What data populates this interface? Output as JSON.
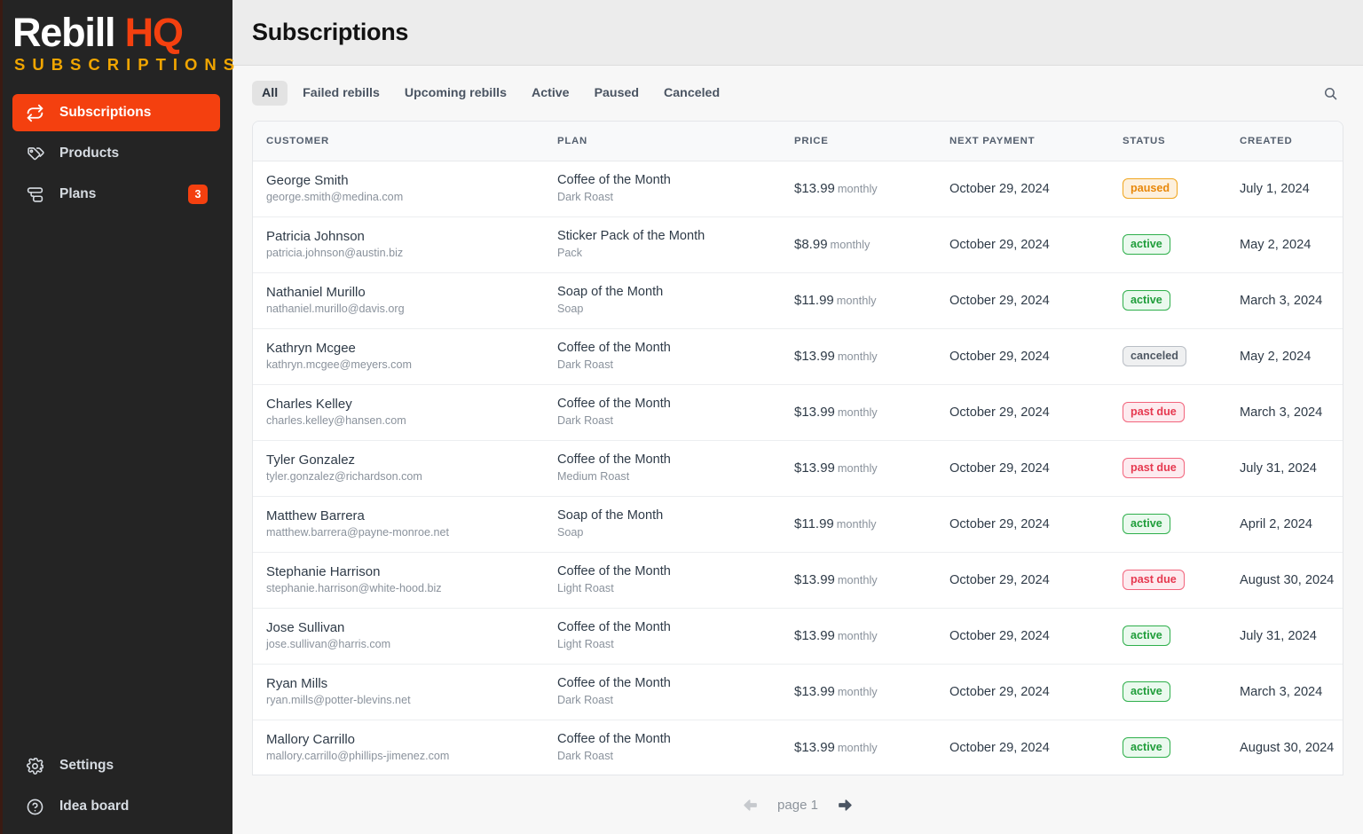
{
  "sidebar": {
    "logo": {
      "name_1": "Rebill",
      "name_2": "HQ",
      "tagline": "SUBSCRIPTIONS"
    },
    "items": [
      {
        "label": "Subscriptions",
        "icon": "refresh-sync-icon",
        "active": true,
        "badge": ""
      },
      {
        "label": "Products",
        "icon": "tag-icon",
        "active": false,
        "badge": ""
      },
      {
        "label": "Plans",
        "icon": "layers-icon",
        "active": false,
        "badge": "3"
      }
    ],
    "bottom_items": [
      {
        "label": "Settings",
        "icon": "gear-icon"
      },
      {
        "label": "Idea board",
        "icon": "question-circle-icon"
      }
    ],
    "accent_color": "#f4400f",
    "tagline_color": "#f0a500",
    "background_color": "#242424"
  },
  "header": {
    "title": "Subscriptions"
  },
  "toolbar": {
    "tabs": [
      {
        "label": "All",
        "selected": true
      },
      {
        "label": "Failed rebills",
        "selected": false
      },
      {
        "label": "Upcoming rebills",
        "selected": false
      },
      {
        "label": "Active",
        "selected": false
      },
      {
        "label": "Paused",
        "selected": false
      },
      {
        "label": "Canceled",
        "selected": false
      }
    ],
    "search_icon": "search-icon"
  },
  "table": {
    "columns": [
      "CUSTOMER",
      "PLAN",
      "PRICE",
      "NEXT PAYMENT",
      "STATUS",
      "CREATED"
    ],
    "rows": [
      {
        "customer": "George Smith",
        "email": "george.smith@medina.com",
        "plan": "Coffee of the Month",
        "variant": "Dark Roast",
        "price": "$13.99",
        "interval": "monthly",
        "next_payment": "October 29, 2024",
        "status": "paused",
        "status_kind": "paused",
        "created": "July 1, 2024"
      },
      {
        "customer": "Patricia Johnson",
        "email": "patricia.johnson@austin.biz",
        "plan": "Sticker Pack of the Month",
        "variant": "Pack",
        "price": "$8.99",
        "interval": "monthly",
        "next_payment": "October 29, 2024",
        "status": "active",
        "status_kind": "active",
        "created": "May 2, 2024"
      },
      {
        "customer": "Nathaniel Murillo",
        "email": "nathaniel.murillo@davis.org",
        "plan": "Soap of the Month",
        "variant": "Soap",
        "price": "$11.99",
        "interval": "monthly",
        "next_payment": "October 29, 2024",
        "status": "active",
        "status_kind": "active",
        "created": "March 3, 2024"
      },
      {
        "customer": "Kathryn Mcgee",
        "email": "kathryn.mcgee@meyers.com",
        "plan": "Coffee of the Month",
        "variant": "Dark Roast",
        "price": "$13.99",
        "interval": "monthly",
        "next_payment": "October 29, 2024",
        "status": "canceled",
        "status_kind": "canceled",
        "created": "May 2, 2024"
      },
      {
        "customer": "Charles Kelley",
        "email": "charles.kelley@hansen.com",
        "plan": "Coffee of the Month",
        "variant": "Dark Roast",
        "price": "$13.99",
        "interval": "monthly",
        "next_payment": "October 29, 2024",
        "status": "past due",
        "status_kind": "pastdue",
        "created": "March 3, 2024"
      },
      {
        "customer": "Tyler Gonzalez",
        "email": "tyler.gonzalez@richardson.com",
        "plan": "Coffee of the Month",
        "variant": "Medium Roast",
        "price": "$13.99",
        "interval": "monthly",
        "next_payment": "October 29, 2024",
        "status": "past due",
        "status_kind": "pastdue",
        "created": "July 31, 2024"
      },
      {
        "customer": "Matthew Barrera",
        "email": "matthew.barrera@payne-monroe.net",
        "plan": "Soap of the Month",
        "variant": "Soap",
        "price": "$11.99",
        "interval": "monthly",
        "next_payment": "October 29, 2024",
        "status": "active",
        "status_kind": "active",
        "created": "April 2, 2024"
      },
      {
        "customer": "Stephanie Harrison",
        "email": "stephanie.harrison@white-hood.biz",
        "plan": "Coffee of the Month",
        "variant": "Light Roast",
        "price": "$13.99",
        "interval": "monthly",
        "next_payment": "October 29, 2024",
        "status": "past due",
        "status_kind": "pastdue",
        "created": "August 30, 2024"
      },
      {
        "customer": "Jose Sullivan",
        "email": "jose.sullivan@harris.com",
        "plan": "Coffee of the Month",
        "variant": "Light Roast",
        "price": "$13.99",
        "interval": "monthly",
        "next_payment": "October 29, 2024",
        "status": "active",
        "status_kind": "active",
        "created": "July 31, 2024"
      },
      {
        "customer": "Ryan Mills",
        "email": "ryan.mills@potter-blevins.net",
        "plan": "Coffee of the Month",
        "variant": "Dark Roast",
        "price": "$13.99",
        "interval": "monthly",
        "next_payment": "October 29, 2024",
        "status": "active",
        "status_kind": "active",
        "created": "March 3, 2024"
      },
      {
        "customer": "Mallory Carrillo",
        "email": "mallory.carrillo@phillips-jimenez.com",
        "plan": "Coffee of the Month",
        "variant": "Dark Roast",
        "price": "$13.99",
        "interval": "monthly",
        "next_payment": "October 29, 2024",
        "status": "active",
        "status_kind": "active",
        "created": "August 30, 2024"
      }
    ]
  },
  "pagination": {
    "prev_icon": "arrow-left-icon",
    "next_icon": "arrow-right-icon",
    "label": "page 1",
    "prev_enabled": false,
    "next_enabled": true
  }
}
